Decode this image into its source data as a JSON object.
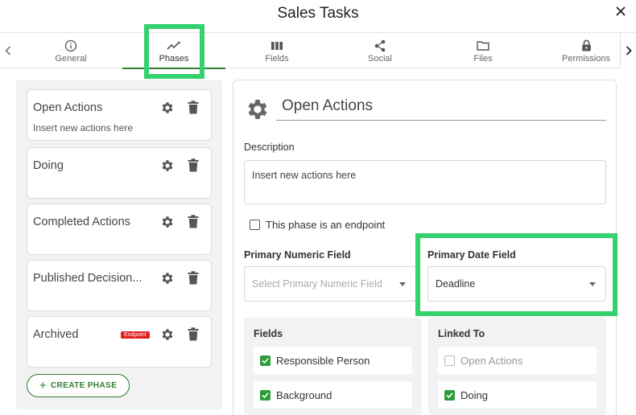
{
  "title": "Sales Tasks",
  "tabs": [
    {
      "label": "General",
      "icon": "info-icon"
    },
    {
      "label": "Phases",
      "icon": "trend-icon"
    },
    {
      "label": "Fields",
      "icon": "columns-icon"
    },
    {
      "label": "Social",
      "icon": "share-icon"
    },
    {
      "label": "Files",
      "icon": "folder-icon"
    },
    {
      "label": "Permissions",
      "icon": "lock-icon"
    }
  ],
  "active_tab": "Phases",
  "phases": [
    {
      "name": "Open Actions",
      "description": "Insert new actions here"
    },
    {
      "name": "Doing",
      "description": ""
    },
    {
      "name": "Completed Actions",
      "description": ""
    },
    {
      "name": "Published Decision...",
      "description": ""
    },
    {
      "name": "Archived",
      "description": "",
      "badge": "Endpoint"
    }
  ],
  "create_phase_label": "CREATE PHASE",
  "detail": {
    "name_value": "Open Actions",
    "description_label": "Description",
    "description_value": "Insert new actions here",
    "endpoint_label": "This phase is an endpoint",
    "endpoint_checked": false,
    "primary_numeric_label": "Primary Numeric Field",
    "primary_numeric_placeholder": "Select Primary Numeric Field",
    "primary_date_label": "Primary Date Field",
    "primary_date_value": "Deadline",
    "fields_title": "Fields",
    "fields": [
      {
        "label": "Responsible Person",
        "checked": true
      },
      {
        "label": "Background",
        "checked": true
      }
    ],
    "linked_title": "Linked To",
    "linked": [
      {
        "label": "Open Actions",
        "checked": false,
        "disabled": true
      },
      {
        "label": "Doing",
        "checked": true,
        "disabled": false
      }
    ]
  },
  "colors": {
    "accent_green": "#2e7d32",
    "highlight_green": "#33d26e",
    "badge_red": "#e01e1e"
  }
}
